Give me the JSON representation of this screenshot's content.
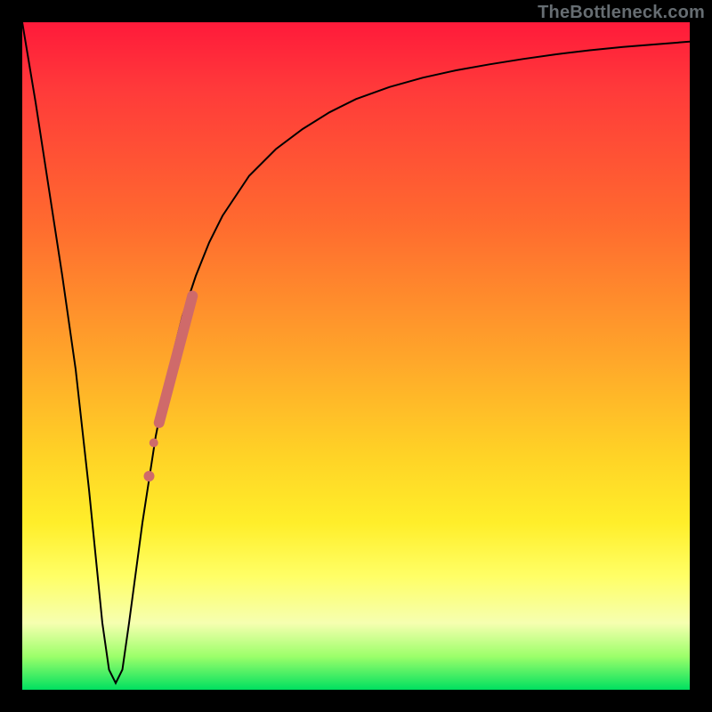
{
  "watermark": "TheBottleneck.com",
  "colors": {
    "curve": "#000000",
    "overlay_stroke": "#cf6a6a",
    "frame_bg": "#000000"
  },
  "chart_data": {
    "type": "line",
    "title": "",
    "xlabel": "",
    "ylabel": "",
    "xlim": [
      0,
      100
    ],
    "ylim": [
      0,
      100
    ],
    "series": [
      {
        "name": "bottleneck-curve",
        "x": [
          0,
          2,
          4,
          6,
          8,
          10,
          11,
          12,
          13,
          14,
          15,
          16,
          18,
          20,
          22,
          24,
          26,
          28,
          30,
          34,
          38,
          42,
          46,
          50,
          55,
          60,
          65,
          70,
          75,
          80,
          85,
          90,
          95,
          100
        ],
        "y": [
          100,
          88,
          75,
          62,
          48,
          30,
          20,
          10,
          3,
          1,
          3,
          10,
          25,
          38,
          48,
          56,
          62,
          67,
          71,
          77,
          81,
          84,
          86.5,
          88.5,
          90.3,
          91.7,
          92.8,
          93.7,
          94.5,
          95.2,
          95.8,
          96.3,
          96.7,
          97.1
        ]
      }
    ],
    "overlay_segment": {
      "name": "highlighted-segment",
      "x": [
        20.5,
        25.5
      ],
      "y": [
        40,
        59
      ],
      "dot_at": {
        "x": 19.0,
        "y": 32
      }
    }
  }
}
